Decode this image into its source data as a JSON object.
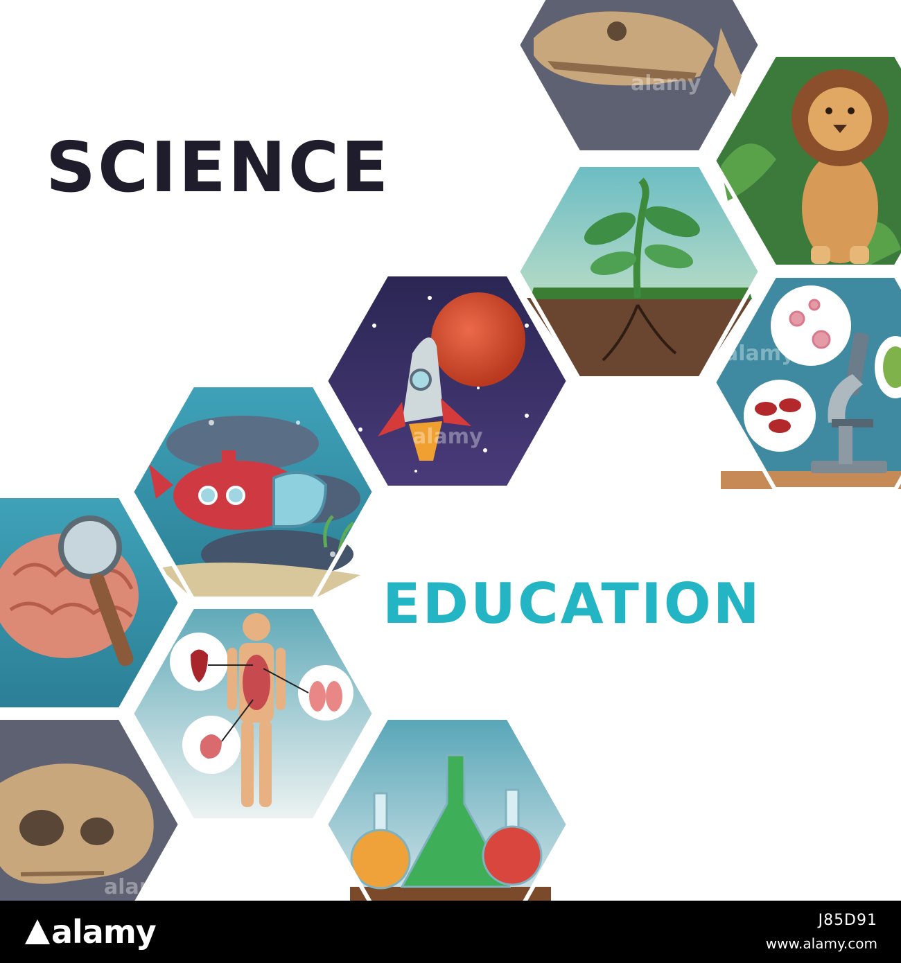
{
  "title_top": "SCIENCE",
  "title_bottom": "EDUCATION",
  "colors": {
    "title_dark": "#1f1d2b",
    "title_teal": "#23b5c3",
    "background": "#ffffff"
  },
  "tiles": [
    {
      "subject": "dinosaur-fossil",
      "icon": "dinosaur-skull-icon"
    },
    {
      "subject": "lion",
      "icon": "lion-icon"
    },
    {
      "subject": "plant-growth",
      "icon": "sprout-icon"
    },
    {
      "subject": "space",
      "icon": "rocket-icon"
    },
    {
      "subject": "microscope",
      "icon": "microscope-icon"
    },
    {
      "subject": "submarine",
      "icon": "submarine-icon"
    },
    {
      "subject": "brain",
      "icon": "brain-magnifier-icon"
    },
    {
      "subject": "human-anatomy",
      "icon": "human-body-icon"
    },
    {
      "subject": "chemistry",
      "icon": "flasks-icon"
    },
    {
      "subject": "skull",
      "icon": "skull-icon"
    }
  ],
  "watermark": "alamy",
  "footer": {
    "logo": "alamy",
    "image_id": "J85D91",
    "url": "www.alamy.com"
  }
}
